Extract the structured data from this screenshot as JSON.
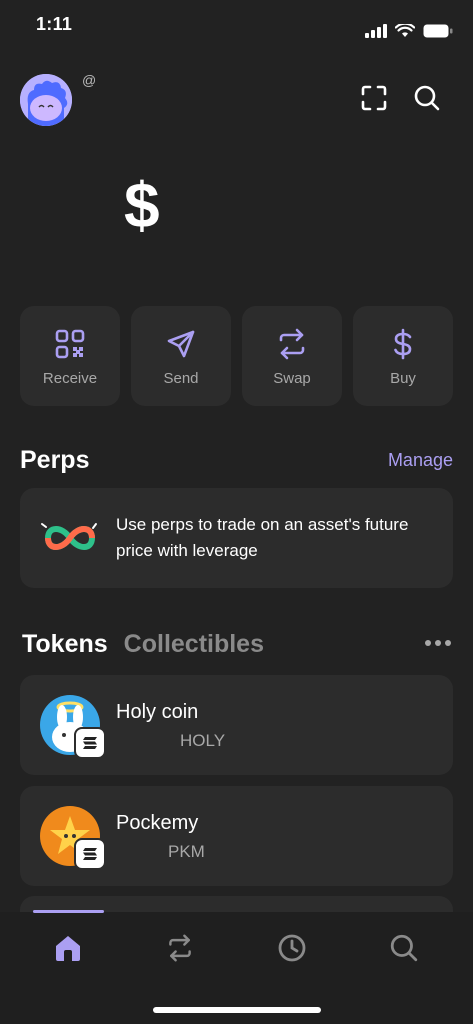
{
  "status_bar": {
    "time": "1:11"
  },
  "header": {
    "at_symbol": "@",
    "icons": [
      "scan-icon",
      "search-icon"
    ]
  },
  "balance": {
    "currency_symbol": "$"
  },
  "actions": [
    {
      "label": "Receive",
      "icon": "qr-code-icon"
    },
    {
      "label": "Send",
      "icon": "send-icon"
    },
    {
      "label": "Swap",
      "icon": "swap-icon"
    },
    {
      "label": "Buy",
      "icon": "dollar-icon"
    }
  ],
  "perps": {
    "title": "Perps",
    "manage_label": "Manage",
    "description": "Use perps to trade on an asset's future price with leverage"
  },
  "tokens_section": {
    "tabs": [
      {
        "label": "Tokens",
        "active": true
      },
      {
        "label": "Collectibles",
        "active": false
      }
    ],
    "items": [
      {
        "name": "Holy coin",
        "symbol": "HOLY"
      },
      {
        "name": "Pockemy",
        "symbol": "PKM"
      }
    ]
  },
  "bottom_nav": {
    "items": [
      "home-icon",
      "swap-icon",
      "history-icon",
      "search-icon"
    ],
    "active": "home-icon"
  },
  "colors": {
    "background": "#222222",
    "card": "#2c2c2c",
    "accent": "#ab9ff2",
    "muted_text": "#a8a8a8"
  }
}
